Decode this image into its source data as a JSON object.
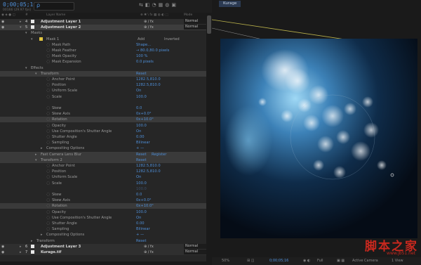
{
  "timeline": {
    "timecode": "0;00;05;16",
    "fps_info": "00166 (29.97 fps)",
    "search_glyph": "ρ",
    "columns": {
      "layer_name": "Layer Name",
      "mode": "Mode"
    },
    "layers": [
      {
        "index": "4",
        "name": "Adjustment Layer 1",
        "mode": "Normal"
      },
      {
        "index": "5",
        "name": "Adjustment Layer 2",
        "mode": "Normal"
      }
    ],
    "masks": {
      "group": "Masks",
      "mask1": {
        "name": "Mask 1",
        "op": "Add",
        "inverted": "Inverted"
      },
      "props": [
        {
          "name": "Mask Path",
          "value": "Shape..."
        },
        {
          "name": "Mask Feather",
          "value": "→ 80.0,80.0 pixels"
        },
        {
          "name": "Mask Opacity",
          "value": "100 %"
        },
        {
          "name": "Mask Expansion",
          "value": "0.0 pixels"
        }
      ]
    },
    "effects": {
      "group": "Effects",
      "transform1": {
        "name": "Transform",
        "reset": "Reset",
        "props": [
          {
            "name": "Anchor Point",
            "value": "1282.5,810.0"
          },
          {
            "name": "Position",
            "value": "1282.5,810.0"
          },
          {
            "name": "Uniform Scale",
            "value": "On"
          },
          {
            "name": "Scale",
            "value": "100.0"
          }
        ],
        "props2": [
          {
            "name": "Skew",
            "value": "0.0"
          },
          {
            "name": "Skew Axis",
            "value": "0x+0.0°"
          },
          {
            "name": "Rotation",
            "value": "0x+10.0°"
          },
          {
            "name": "Opacity",
            "value": "100.0"
          },
          {
            "name": "Use Composition's Shutter Angle",
            "value": "On"
          },
          {
            "name": "Shutter Angle",
            "value": "0.00"
          },
          {
            "name": "Sampling",
            "value": "Bilinear"
          }
        ],
        "compositing": "Compositing Options"
      },
      "lens_blur": {
        "name": "Fast Camera Lens Blur",
        "reset": "Reset",
        "register": "Register"
      },
      "transform2": {
        "name": "Transform 2",
        "reset": "Reset",
        "props": [
          {
            "name": "Anchor Point",
            "value": "1282.5,810.0"
          },
          {
            "name": "Position",
            "value": "1282.5,810.0"
          },
          {
            "name": "Uniform Scale",
            "value": "On"
          },
          {
            "name": "Scale",
            "value": "100.0"
          }
        ],
        "scale_dim": "100.0",
        "props2": [
          {
            "name": "Skew",
            "value": "0.0"
          },
          {
            "name": "Skew Axis",
            "value": "0x+0.0°"
          },
          {
            "name": "Rotation",
            "value": "0x+10.0°"
          },
          {
            "name": "Opacity",
            "value": "100.0"
          },
          {
            "name": "Use Composition's Shutter Angle",
            "value": "On"
          },
          {
            "name": "Shutter Angle",
            "value": "0.00"
          },
          {
            "name": "Sampling",
            "value": "Bilinear"
          }
        ],
        "compositing": "Compositing Options"
      }
    },
    "transform_group": {
      "name": "Transform",
      "reset": "Reset"
    },
    "layers_bottom": [
      {
        "index": "6",
        "name": "Adjustment Layer 3",
        "mode": "Normal"
      },
      {
        "index": "7",
        "name": "Kurage.tif",
        "mode": "Normal"
      }
    ]
  },
  "viewer": {
    "tab": "Kurage",
    "zoom": "50%",
    "timecode": "0;00;05;16",
    "resolution": "Full",
    "camera": "Active Camera",
    "views": "1 View"
  },
  "watermark": {
    "text": "脚本之家",
    "url": "www.jb51.net"
  },
  "colors": {
    "accent": "#4f8fd8",
    "watermark": "#c8281e",
    "selection": "#3d3d3d"
  }
}
